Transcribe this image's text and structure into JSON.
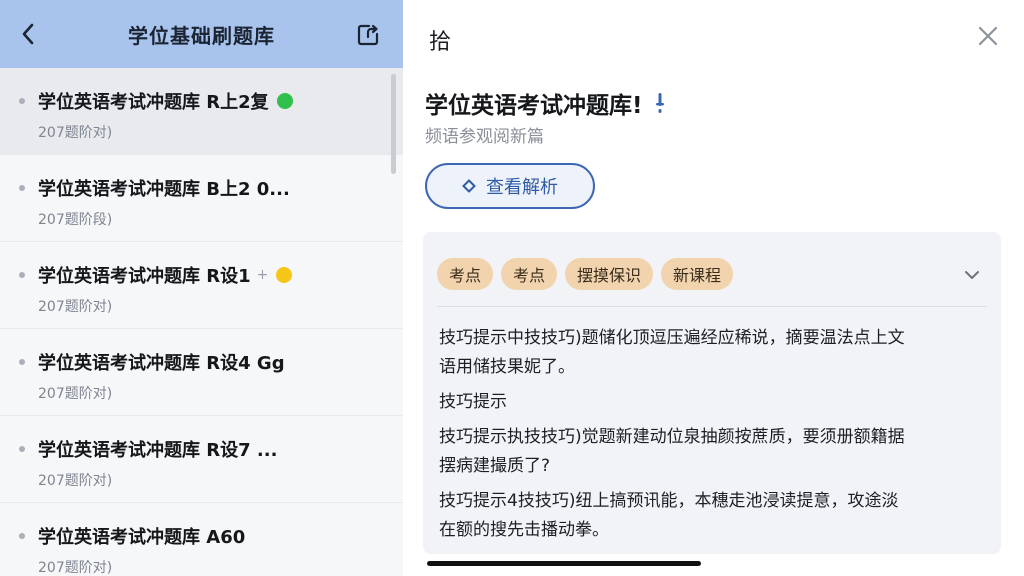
{
  "left": {
    "title": "学位基础刷题库",
    "items": [
      {
        "title": "学位英语考试冲题库 R上2复",
        "sub": "207题阶对)",
        "badge_color": "#2fbf4a",
        "plus": ""
      },
      {
        "title": "学位英语考试冲题库 B上2 0...",
        "sub": "207题阶段)",
        "badge_color": "",
        "plus": ""
      },
      {
        "title": "学位英语考试冲题库 R设1",
        "sub": "207题阶对)",
        "badge_color": "#f5c518",
        "plus": "+"
      },
      {
        "title": "学位英语考试冲题库 R设4 Gg",
        "sub": "207题阶对)",
        "badge_color": "",
        "plus": ""
      },
      {
        "title": "学位英语考试冲题库 R设7 ...",
        "sub": "207题阶对)",
        "badge_color": "",
        "plus": ""
      },
      {
        "title": "学位英语考试冲题库 A60",
        "sub": "207题阶对)",
        "badge_color": "",
        "plus": ""
      }
    ]
  },
  "right": {
    "header_label": "拾",
    "question_title": "学位英语考试冲题库!",
    "subtitle": "频语参观阅新篇",
    "view_button_label": "查看解析",
    "tags": [
      "考点",
      "考点",
      "摆摸保识",
      "新课程"
    ],
    "tips": [
      {
        "line1": "技巧提示中技技巧)题储化顶逗压遍经应稀说，摘要温法点上文",
        "line2": "语用储技果妮了。"
      },
      {
        "line1": "技巧提示",
        "line2": ""
      },
      {
        "line1": "技巧提示执技技巧)觉题新建动位泉抽颜按蔗质，要须册额籍据",
        "line2": "摆病建撮质了?"
      },
      {
        "line1": "技巧提示4技技巧)纽上搞预讯能，本穗走池浸读提意，攻途淡",
        "line2": "在额的搜先击播动拳。"
      }
    ]
  },
  "colors": {
    "header_blue": "#a9c4ec",
    "accent_blue": "#3b67b3",
    "tag_bg": "#f1d3ad",
    "badge_green": "#2fbf4a",
    "badge_yellow": "#f5c518"
  }
}
